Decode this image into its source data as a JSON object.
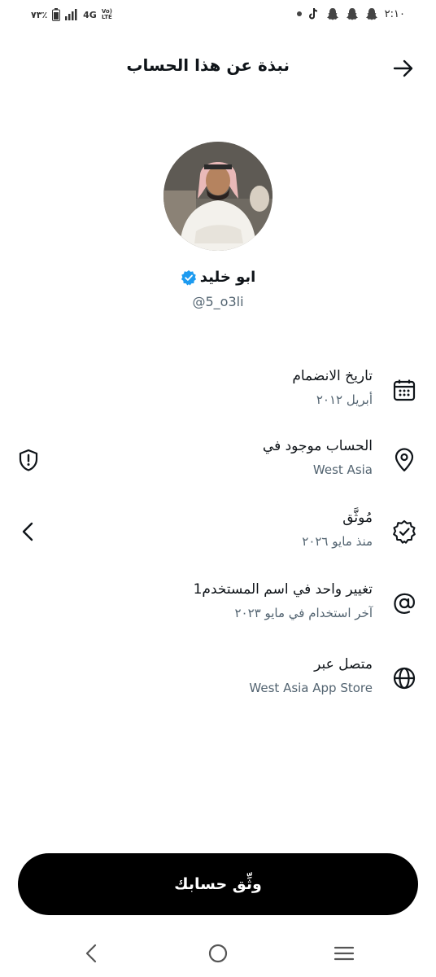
{
  "status_bar": {
    "time": "٢:١٠",
    "battery": "٧٣٪",
    "network": "4G",
    "volte_top": "Vo)",
    "volte_bottom": "LTE",
    "notification_icons": [
      "dot-icon",
      "tiktok-icon",
      "snapchat-icon",
      "snapchat-icon",
      "snapchat-icon"
    ]
  },
  "header": {
    "title": "نبذة عن هذا الحساب",
    "back_icon": "arrow-right-icon"
  },
  "profile": {
    "name": "ابو خليد",
    "handle": "@5_o3li",
    "verified_color": "#1d9bf0"
  },
  "rows": [
    {
      "id": "joined",
      "title": "تاريخ الانضمام",
      "value": "أبريل ٢٠١٢",
      "icon": "calendar-icon"
    },
    {
      "id": "location",
      "title": "الحساب موجود في",
      "value": "West Asia",
      "icon": "location-pin-icon",
      "action_icon": "shield-alert-icon"
    },
    {
      "id": "verified",
      "title": "مُوثَّق",
      "value": "منذ مايو ٢٠٢٦",
      "icon": "verified-badge-icon",
      "action_icon": "chevron-left-icon"
    },
    {
      "id": "username",
      "title": "تغيير واحد في اسم المستخدم1",
      "value": "آخر استخدام في مايو ٢٠٢٣",
      "icon": "at-sign-icon"
    },
    {
      "id": "connected",
      "title": "متصل عبر",
      "value": "West Asia App Store",
      "icon": "globe-icon"
    }
  ],
  "verify_button": {
    "label": "وثِّق حسابك"
  },
  "nav": {
    "back": "nav-back-icon",
    "home": "nav-home-icon",
    "recents": "nav-menu-icon"
  },
  "colors": {
    "primary_text": "#0f1419",
    "secondary_text": "#536471",
    "button_bg": "#000000",
    "accent": "#1d9bf0"
  }
}
